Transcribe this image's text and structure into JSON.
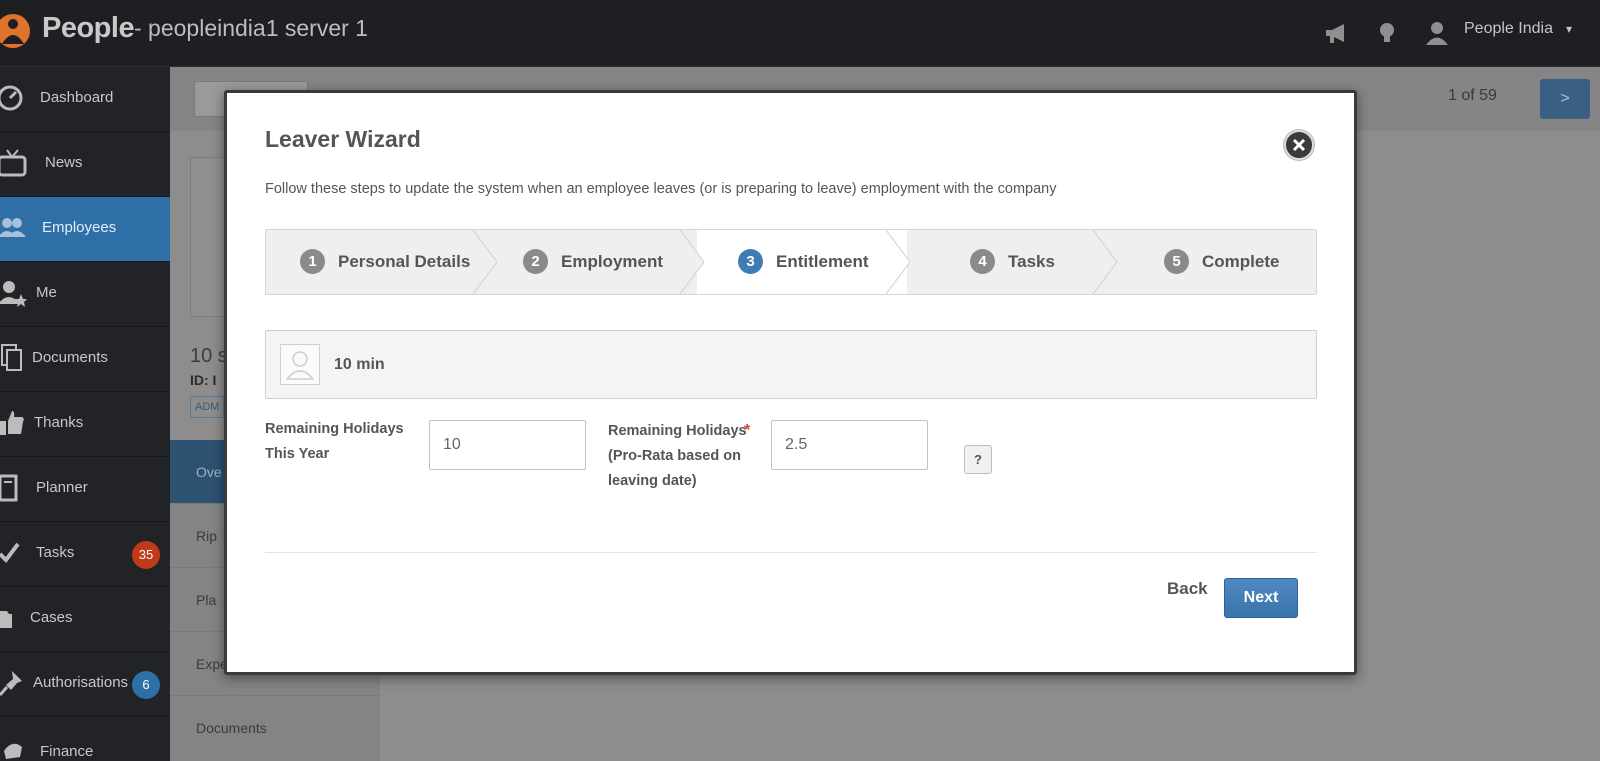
{
  "topbar": {
    "brand": "People",
    "server": "- peopleindia1 server 1",
    "user_name": "People India",
    "user_caret": "▾",
    "icons": [
      "megaphone-icon",
      "lightbulb-icon",
      "user-icon"
    ]
  },
  "sidebar": {
    "items": [
      {
        "label": "Dashboard",
        "icon": "speedometer-icon"
      },
      {
        "label": "News",
        "icon": "tv-icon"
      },
      {
        "label": "Employees",
        "icon": "people-icon",
        "active": true
      },
      {
        "label": "Me",
        "icon": "user-star-icon"
      },
      {
        "label": "Documents",
        "icon": "documents-icon"
      },
      {
        "label": "Thanks",
        "icon": "thumbs-up-icon"
      },
      {
        "label": "Planner",
        "icon": "planner-icon"
      },
      {
        "label": "Tasks",
        "icon": "check-icon",
        "badge": "35"
      },
      {
        "label": "Cases",
        "icon": "folder-icon"
      },
      {
        "label": "Authorisations",
        "icon": "pin-icon",
        "badge": "6"
      },
      {
        "label": "Finance",
        "icon": "finance-icon"
      }
    ],
    "badge_colors": {
      "tasks": "#c0391b",
      "authorisations": "#2f6fa8"
    }
  },
  "background": {
    "count": "1 of 59",
    "next": ">",
    "employee_name": "10 s",
    "employee_id": "ID: I",
    "tag": "ADM",
    "menu": [
      "Ove",
      "Rip",
      "Pla",
      "Expenses",
      "Documents"
    ]
  },
  "modal": {
    "title": "Leaver Wizard",
    "description": "Follow these steps to update the system when an employee leaves (or is preparing to leave) employment with the company",
    "steps": [
      {
        "number": "1",
        "label": "Personal Details"
      },
      {
        "number": "2",
        "label": "Employment"
      },
      {
        "number": "3",
        "label": "Entitlement",
        "current": true
      },
      {
        "number": "4",
        "label": "Tasks"
      },
      {
        "number": "5",
        "label": "Complete"
      }
    ],
    "employee": {
      "name": "10 min"
    },
    "fields": {
      "remaining_this_year": {
        "label": "Remaining Holidays This Year",
        "value": "10"
      },
      "remaining_pro_rata": {
        "label": "Remaining Holidays (Pro-Rata based on leaving date)",
        "value": "2.5",
        "required_mark": "*"
      }
    },
    "help_label": "?",
    "back_label": "Back",
    "next_label": "Next",
    "accent_color": "#3f7cb6"
  }
}
